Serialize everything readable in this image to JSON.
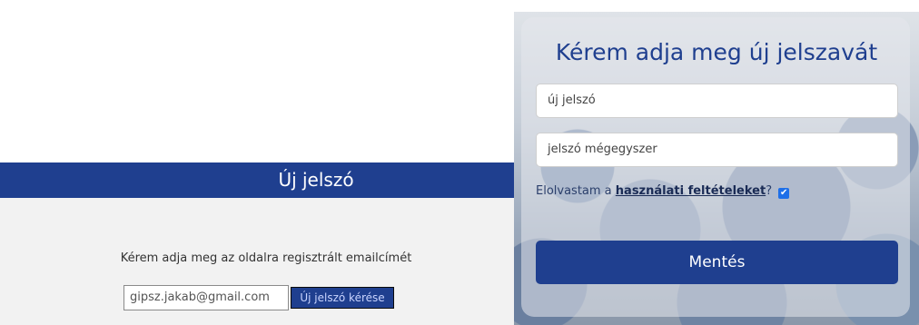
{
  "left_panel": {
    "banner_title": "Új jelszó",
    "prompt": "Kérem adja meg az oldalra regisztrált emailcímét",
    "email_value": "gipsz.jakab@gmail.com",
    "request_button_label": "Új jelszó kérése",
    "banner_color": "#1f3f8f"
  },
  "right_panel": {
    "title": "Kérem adja meg új jelszavát",
    "password_placeholder": "új jelszó",
    "confirm_placeholder": "jelszó mégegyszer",
    "terms_prefix": "Elolvastam a ",
    "terms_link": "használati feltételeket",
    "terms_suffix": "?",
    "terms_checked": true,
    "save_button_label": "Mentés",
    "accent_color": "#1f3f8f"
  }
}
